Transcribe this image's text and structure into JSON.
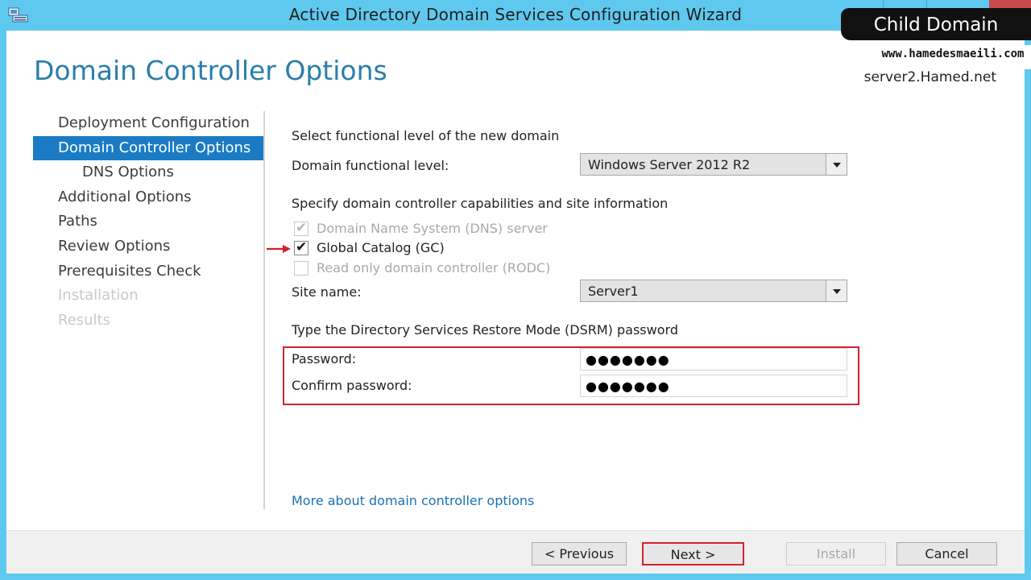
{
  "window": {
    "title": "Active Directory Domain Services Configuration Wizard"
  },
  "header": {
    "page_title": "Domain Controller Options",
    "server_name": "server2.Hamed.net"
  },
  "overlay": {
    "title": "Child Domain",
    "url": "www.hamedesmaeili.com"
  },
  "nav": {
    "items": [
      {
        "label": "Deployment Configuration",
        "state": "normal"
      },
      {
        "label": "Domain Controller Options",
        "state": "active"
      },
      {
        "label": "DNS Options",
        "state": "normal"
      },
      {
        "label": "Additional Options",
        "state": "normal"
      },
      {
        "label": "Paths",
        "state": "normal"
      },
      {
        "label": "Review Options",
        "state": "normal"
      },
      {
        "label": "Prerequisites Check",
        "state": "normal"
      },
      {
        "label": "Installation",
        "state": "disabled"
      },
      {
        "label": "Results",
        "state": "disabled"
      }
    ]
  },
  "form": {
    "functional_heading": "Select functional level of the new domain",
    "functional_label": "Domain functional level:",
    "functional_value": "Windows Server 2012 R2",
    "capabilities_heading": "Specify domain controller capabilities and site information",
    "dns_label": "Domain Name System (DNS) server",
    "gc_label": "Global Catalog (GC)",
    "rodc_label": "Read only domain controller (RODC)",
    "site_label": "Site name:",
    "site_value": "Server1",
    "dsrm_heading": "Type the Directory Services Restore Mode (DSRM) password",
    "password_label": "Password:",
    "password_value": "●●●●●●●",
    "confirm_label": "Confirm password:",
    "confirm_value": "●●●●●●●"
  },
  "checkbox_states": {
    "dns": {
      "checked": true,
      "enabled": false
    },
    "gc": {
      "checked": true,
      "enabled": true
    },
    "rodc": {
      "checked": false,
      "enabled": false
    }
  },
  "link": {
    "text": "More about domain controller options"
  },
  "buttons": {
    "previous": "< Previous",
    "next": "Next >",
    "install": "Install",
    "cancel": "Cancel"
  },
  "colors": {
    "accent": "#1a7bc4",
    "highlight_red": "#d3212d",
    "title_blue": "#2a7ea8",
    "frame": "#5fc8ee"
  }
}
